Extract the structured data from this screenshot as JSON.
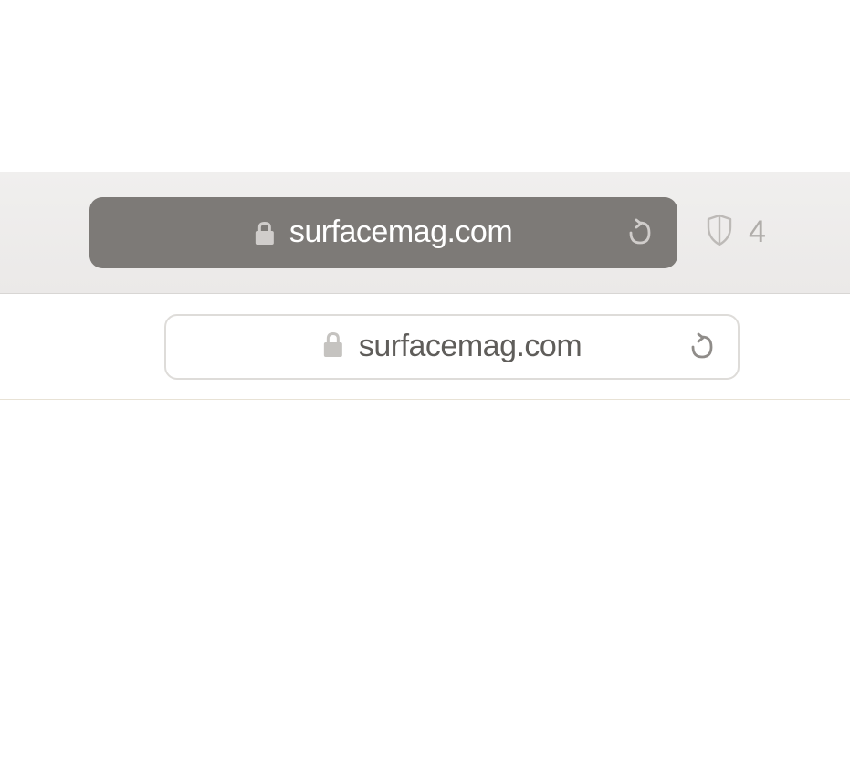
{
  "toolbar": {
    "address_bar_dark": {
      "domain": "surfacemag.com",
      "lock_icon": "lock-icon",
      "reload_icon": "reload-icon"
    },
    "tracker": {
      "shield_icon": "shield-icon",
      "count": "4"
    }
  },
  "content": {
    "address_bar_light": {
      "domain": "surfacemag.com",
      "lock_icon": "lock-icon",
      "reload_icon": "reload-icon"
    }
  }
}
